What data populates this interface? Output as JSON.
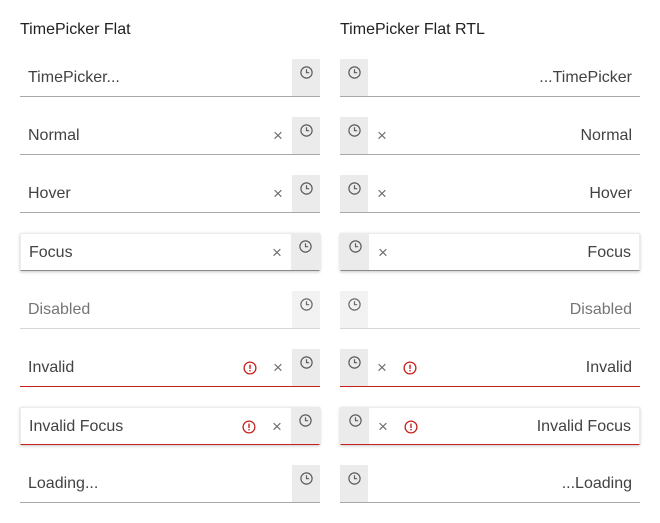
{
  "ltr": {
    "title": "TimePicker Flat",
    "pickers": [
      {
        "value": "TimePicker..."
      },
      {
        "value": "Normal"
      },
      {
        "value": "Hover"
      },
      {
        "value": "Focus"
      },
      {
        "value": "Disabled"
      },
      {
        "value": "Invalid"
      },
      {
        "value": "Invalid Focus"
      },
      {
        "value": "Loading..."
      }
    ]
  },
  "rtl": {
    "title": "TimePicker Flat RTL",
    "pickers": [
      {
        "value": "...TimePicker"
      },
      {
        "value": "Normal"
      },
      {
        "value": "Hover"
      },
      {
        "value": "Focus"
      },
      {
        "value": "Disabled"
      },
      {
        "value": "Invalid"
      },
      {
        "value": "Invalid Focus"
      },
      {
        "value": "...Loading"
      }
    ]
  },
  "icons": {
    "clear": "×",
    "clock": "clock-icon",
    "error": "error-icon"
  },
  "colors": {
    "text": "#424242",
    "underline": "#a8a8a8",
    "error": "#c5221f",
    "button_bg": "#ebebeb",
    "clear_icon": "#6f6f6f"
  }
}
